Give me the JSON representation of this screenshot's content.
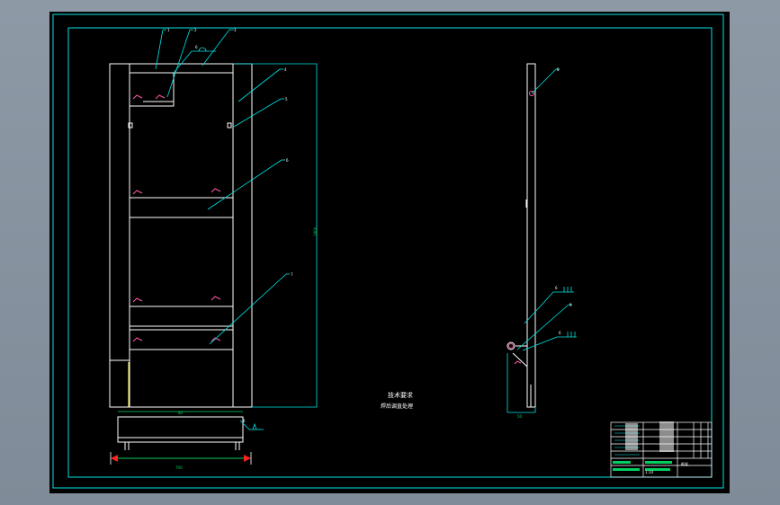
{
  "colors": {
    "background": "#000000",
    "frame": "#00e5e5",
    "object": "#ffffff",
    "leader": "#00e5e5",
    "weld_mark": "#ff5aa8",
    "dimension": "#00d060",
    "arrow": "#ff2020",
    "accent_yellow": "#ffff66"
  },
  "notes": {
    "line1": "技术要求",
    "line2": "焊后调直处理"
  },
  "front_view": {
    "balloons": [
      "1",
      "2",
      "3",
      "4",
      "5",
      "6",
      "7"
    ],
    "weld_symbol_label": "6",
    "height_dim": "1800",
    "top_width_dim": "80",
    "bottom_width_dim": "700"
  },
  "side_view": {
    "balloons": [
      "8",
      "9"
    ],
    "weld_symbol_labels": [
      "6",
      "6"
    ],
    "width_dim": "50"
  },
  "title_block": {
    "drawing_name": "框架",
    "scale_label": "1:10"
  }
}
